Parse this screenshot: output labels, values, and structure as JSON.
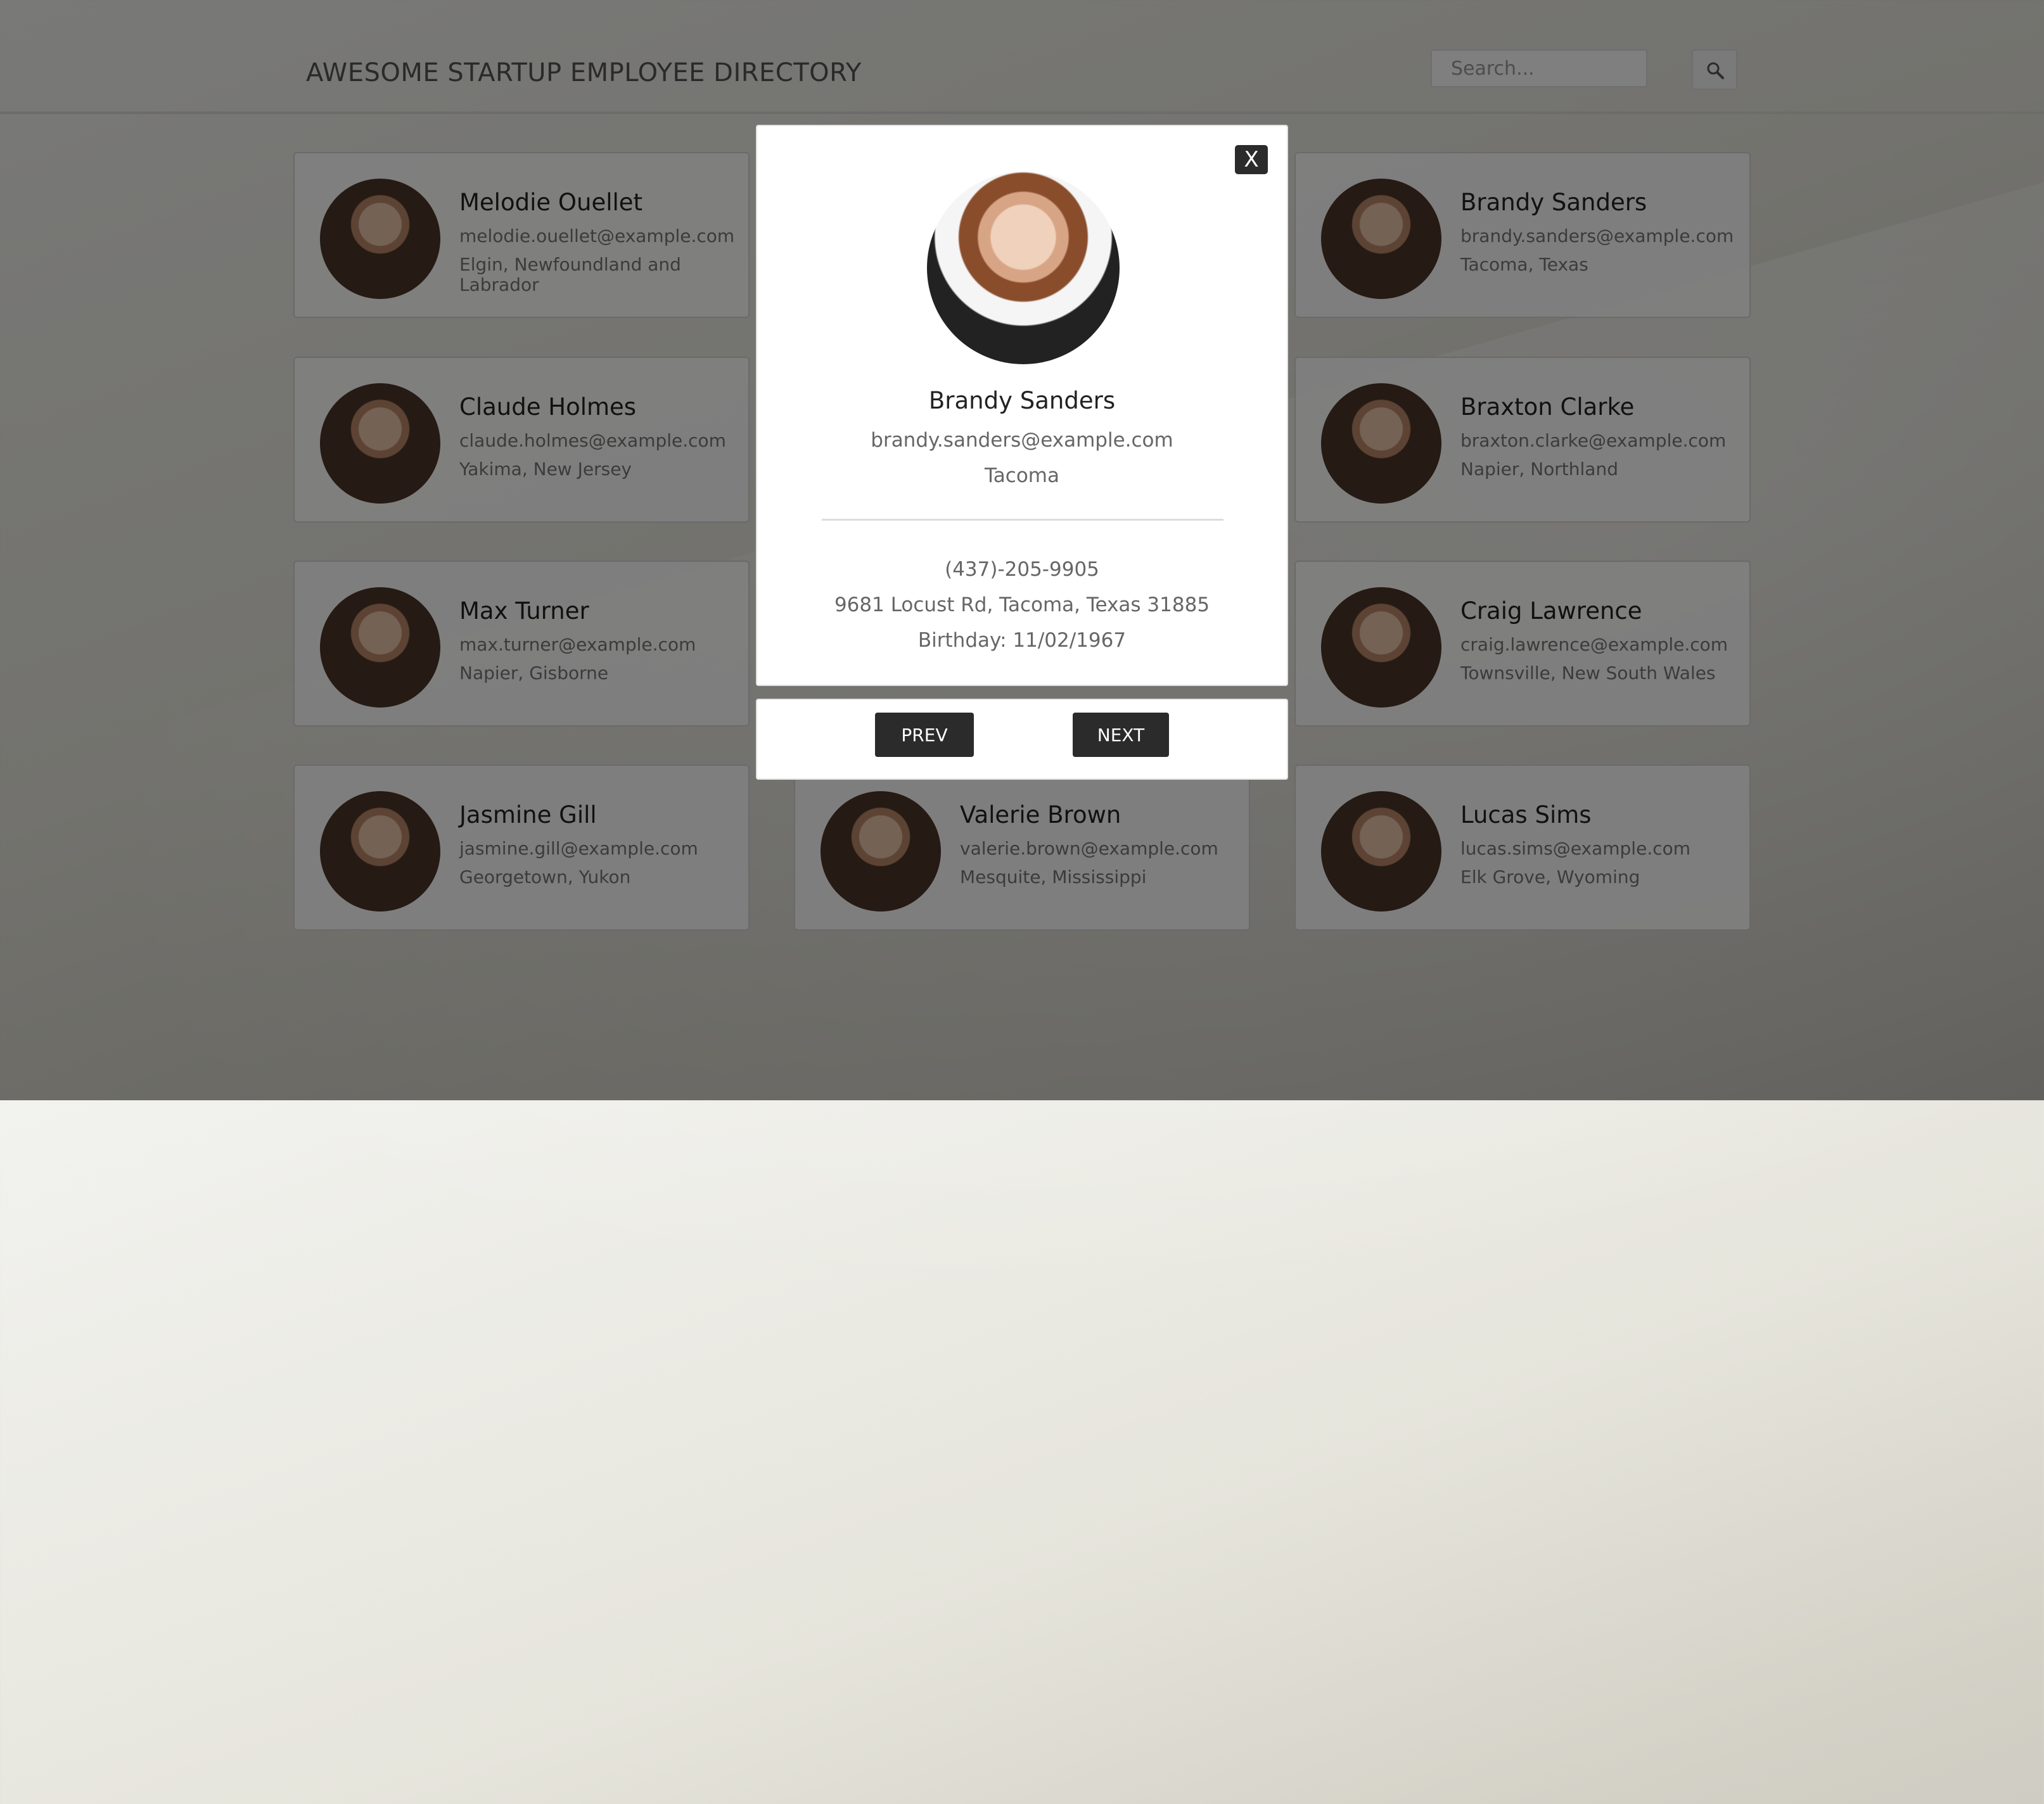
{
  "header": {
    "title": "AWESOME STARTUP EMPLOYEE DIRECTORY",
    "search_placeholder": "Search..."
  },
  "employees": [
    {
      "name": "Melodie Ouellet",
      "email": "melodie.ouellet@example.com",
      "location": "Elgin, Newfoundland and Labrador"
    },
    {
      "name": "Brandy Sanders",
      "email": "brandy.sanders@example.com",
      "location": "Tacoma, Texas"
    },
    {
      "name": "Claude Holmes",
      "email": "claude.holmes@example.com",
      "location": "Yakima, New Jersey"
    },
    {
      "name": "Braxton Clarke",
      "email": "braxton.clarke@example.com",
      "location": "Napier, Northland"
    },
    {
      "name": "Max Turner",
      "email": "max.turner@example.com",
      "location": "Napier, Gisborne"
    },
    {
      "name": "Craig Lawrence",
      "email": "craig.lawrence@example.com",
      "location": "Townsville, New South Wales"
    },
    {
      "name": "Jasmine Gill",
      "email": "jasmine.gill@example.com",
      "location": "Georgetown, Yukon"
    },
    {
      "name": "Valerie Brown",
      "email": "valerie.brown@example.com",
      "location": "Mesquite, Mississippi"
    },
    {
      "name": "Lucas Sims",
      "email": "lucas.sims@example.com",
      "location": "Elk Grove, Wyoming"
    }
  ],
  "modal": {
    "close_label": "X",
    "name": "Brandy Sanders",
    "email": "brandy.sanders@example.com",
    "city": "Tacoma",
    "phone": "(437)-205-9905",
    "address": "9681 Locust Rd, Tacoma, Texas 31885",
    "birthday": "Birthday: 11/02/1967"
  },
  "nav": {
    "prev_label": "PREV",
    "next_label": "NEXT"
  }
}
